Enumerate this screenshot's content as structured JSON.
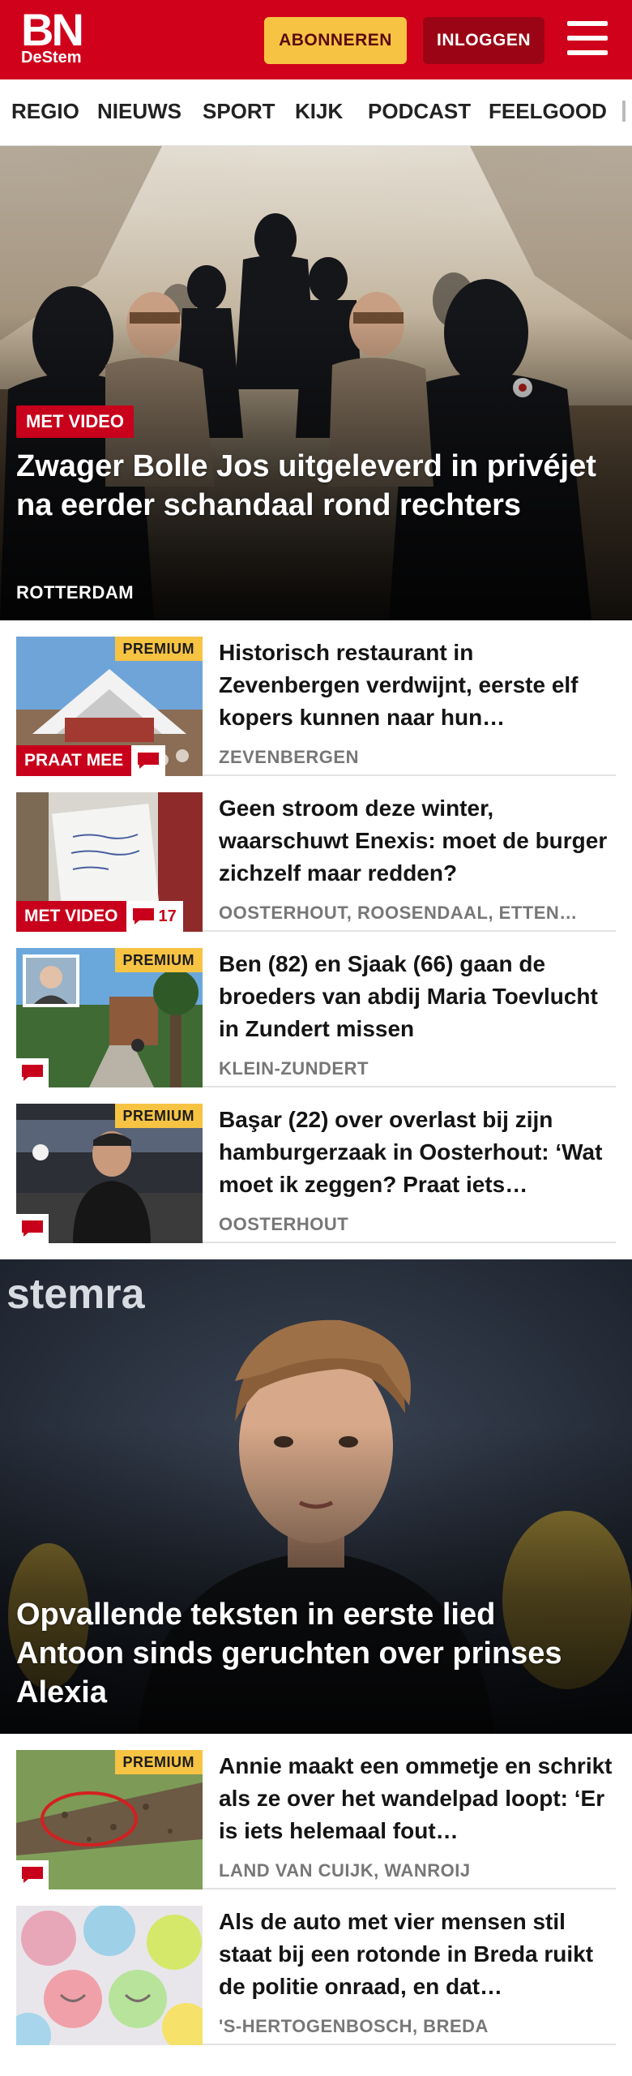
{
  "brand": {
    "logo_main": "BN",
    "logo_sub": "DeStem"
  },
  "header": {
    "subscribe_label": "ABONNEREN",
    "login_label": "INLOGGEN"
  },
  "nav": {
    "items": [
      "REGIO",
      "NIEUWS",
      "SPORT",
      "KIJK",
      "PODCAST",
      "FEELGOOD"
    ]
  },
  "hero": {
    "badge": "MET VIDEO",
    "title": "Zwager Bolle Jos uitgeleverd in privéjet na eerder schandaal rond rechters",
    "location": "ROTTERDAM"
  },
  "articles": [
    {
      "premium": "PREMIUM",
      "badge": "PRAAT MEE",
      "title": "Historisch restaurant in Zevenbergen verdwijnt, eerste elf kopers kunnen naar hun…",
      "location": "ZEVENBERGEN"
    },
    {
      "badge": "MET VIDEO",
      "comments": "17",
      "title": "Geen stroom deze winter, waarschuwt Enexis: moet de burger zichzelf maar redden?",
      "location": "OOSTERHOUT, ROOSENDAAL, ETTEN…"
    },
    {
      "premium": "PREMIUM",
      "title": "Ben (82) en Sjaak (66) gaan de broeders van abdij Maria Toevlucht in Zundert missen",
      "location": "KLEIN-ZUNDERT"
    },
    {
      "premium": "PREMIUM",
      "title": "Başar (22) over overlast bij zijn hamburgerzaak in Oosterhout: ‘Wat moet ik zeggen? Praat iets…",
      "location": "OOSTERHOUT"
    }
  ],
  "hero2": {
    "title": "Opvallende teksten in eerste lied Antoon sinds geruchten over prinses Alexia",
    "backdrop_text": "stemra"
  },
  "articles2": [
    {
      "premium": "PREMIUM",
      "title": "Annie maakt een ommetje en schrikt als ze over het wandelpad loopt: ‘Er is iets helemaal fout…",
      "location": "LAND VAN CUIJK, WANROIJ"
    },
    {
      "title": "Als de auto met vier mensen stil staat bij een rotonde in Breda ruikt de politie onraad, en dat…",
      "location": "'S-HERTOGENBOSCH, BREDA"
    }
  ],
  "colors": {
    "brand_red": "#d0021b",
    "premium_yellow": "#f6c343",
    "login_dark_red": "#9b0414"
  }
}
